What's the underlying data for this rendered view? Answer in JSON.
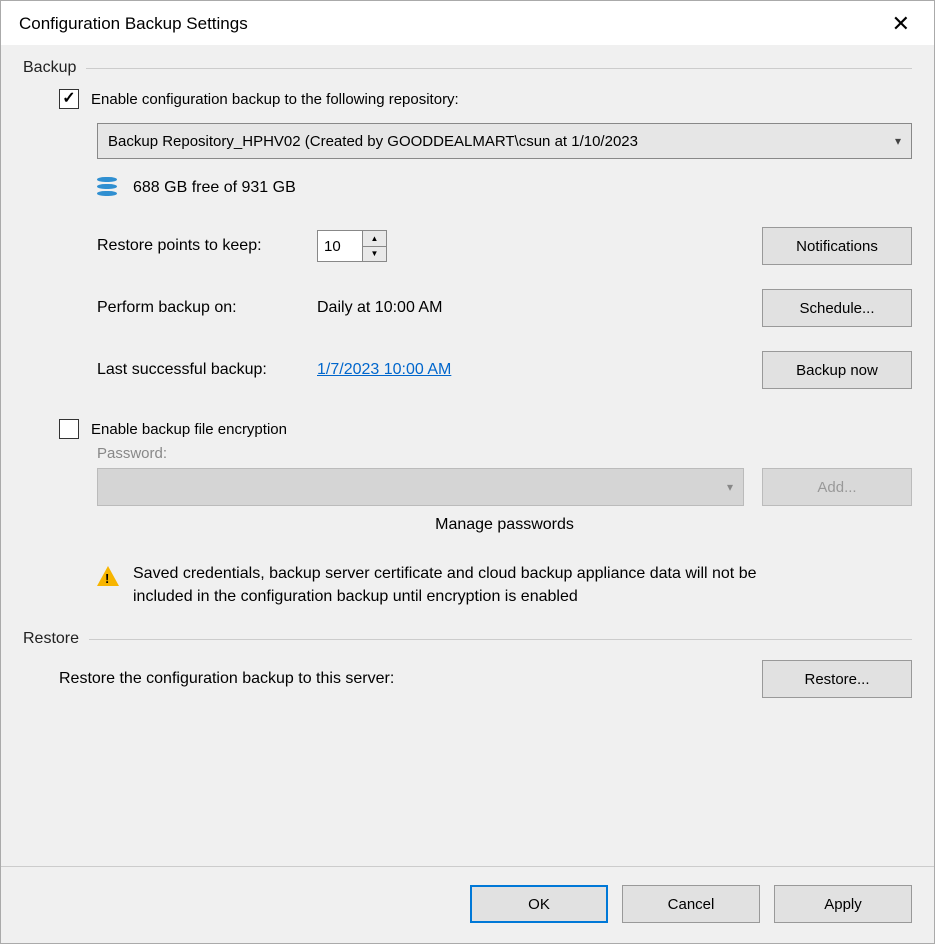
{
  "title": "Configuration Backup Settings",
  "backup": {
    "group_label": "Backup",
    "enable_label": "Enable configuration backup to the following repository:",
    "enable_checked": true,
    "repository": "Backup Repository_HPHV02 (Created by GOODDEALMART\\csun at 1/10/2023",
    "free_space": "688 GB free of 931 GB",
    "restore_points_label": "Restore points to keep:",
    "restore_points_value": "10",
    "notifications_btn": "Notifications",
    "perform_label": "Perform backup on:",
    "perform_value": "Daily at 10:00 AM",
    "schedule_btn": "Schedule...",
    "last_label": "Last successful backup:",
    "last_value": "1/7/2023 10:00 AM",
    "backup_now_btn": "Backup now",
    "encrypt_label": "Enable backup file encryption",
    "encrypt_checked": false,
    "password_label": "Password:",
    "add_btn": "Add...",
    "manage_link": "Manage passwords",
    "warning": "Saved credentials, backup server certificate and cloud backup appliance data will not be included in the configuration backup until encryption is enabled"
  },
  "restore": {
    "group_label": "Restore",
    "text": "Restore the configuration backup to this server:",
    "restore_btn": "Restore..."
  },
  "footer": {
    "ok": "OK",
    "cancel": "Cancel",
    "apply": "Apply"
  }
}
